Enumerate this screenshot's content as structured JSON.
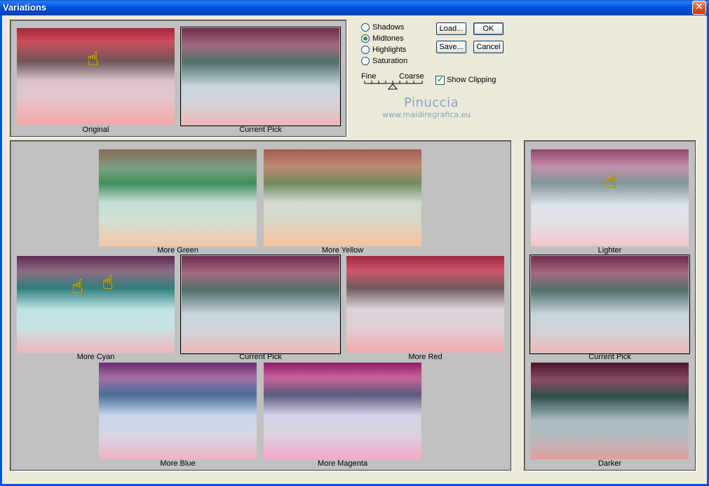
{
  "window": {
    "title": "Variations",
    "close_glyph": "✕"
  },
  "tones": [
    {
      "label": "Shadows",
      "checked": false
    },
    {
      "label": "Midtones",
      "checked": true
    },
    {
      "label": "Highlights",
      "checked": false
    },
    {
      "label": "Saturation",
      "checked": false
    }
  ],
  "buttons": {
    "load": "Load...",
    "ok": "OK",
    "save": "Save...",
    "cancel": "Cancel"
  },
  "slider": {
    "fine": "Fine",
    "coarse": "Coarse"
  },
  "show_clipping": {
    "label": "Show Clipping",
    "checked": true,
    "mark": "✓"
  },
  "watermark": {
    "name": "Pinuccia",
    "url": "www.maidiregrafica.eu"
  },
  "previews": {
    "original": "Original",
    "current_pick": "Current Pick",
    "more_green": "More Green",
    "more_yellow": "More Yellow",
    "more_cyan": "More Cyan",
    "more_red": "More Red",
    "more_blue": "More Blue",
    "more_magenta": "More Magenta",
    "lighter": "Lighter",
    "darker": "Darker"
  },
  "icons": {
    "hand": "☝"
  },
  "colors": {
    "title_bar": "#0054E3",
    "dialog_bg": "#ECE9D8",
    "panel_bg": "#C0C0C0",
    "close_button": "#D8512D"
  }
}
